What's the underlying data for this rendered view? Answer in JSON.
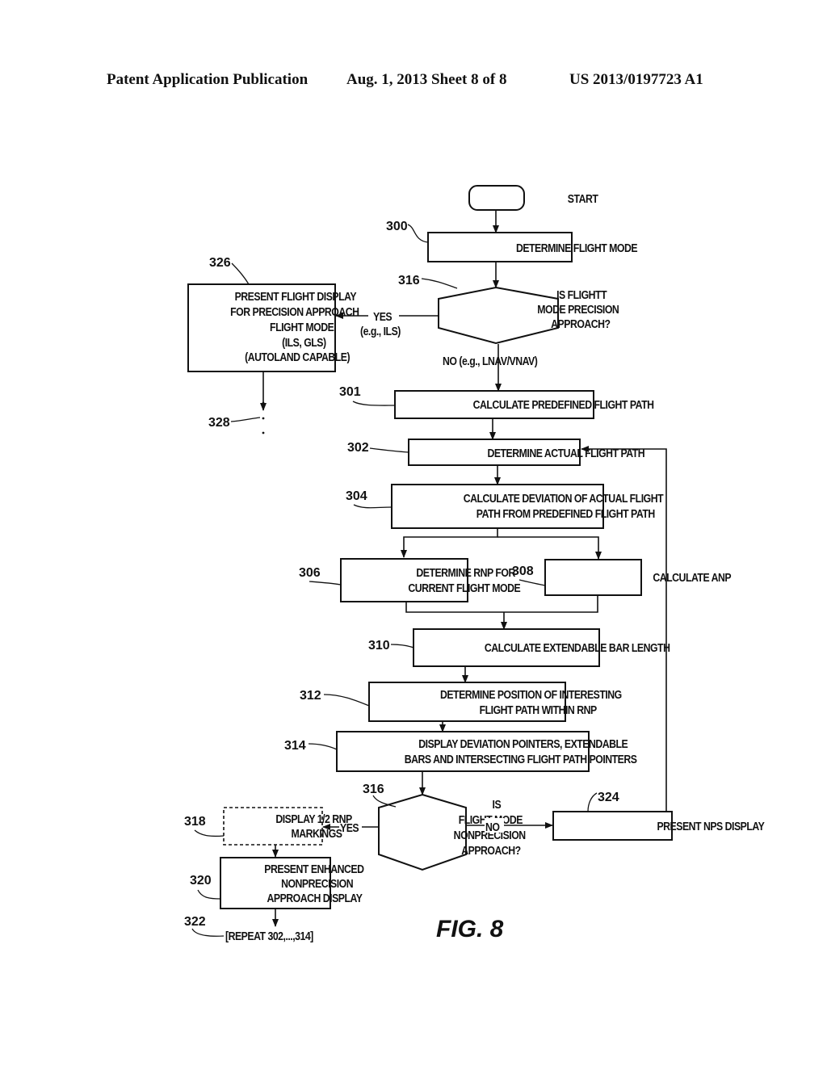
{
  "header": {
    "left": "Patent Application Publication",
    "middle": "Aug. 1, 2013   Sheet 8 of 8",
    "right": "US 2013/0197723 A1"
  },
  "figure_label": "FIG. 8",
  "nodes": {
    "start": {
      "lines": [
        "START"
      ]
    },
    "n300": {
      "ref": "300",
      "lines": [
        "DETERMINE FLIGHT MODE"
      ]
    },
    "n316a": {
      "ref": "316",
      "lines": [
        "IS FLIGHTT",
        "MODE PRECISION",
        "APPROACH?"
      ]
    },
    "n326": {
      "ref": "326",
      "lines": [
        "PRESENT FLIGHT DISPLAY",
        "FOR PRECISION APPROACH",
        "FLIGHT MODE",
        "(ILS, GLS)",
        "(AUTOLAND CAPABLE)"
      ]
    },
    "n328": {
      "ref": "328"
    },
    "n301": {
      "ref": "301",
      "lines": [
        "CALCULATE PREDEFINED FLIGHT PATH"
      ]
    },
    "n302": {
      "ref": "302",
      "lines": [
        "DETERMINE ACTUAL FLIGHT PATH"
      ]
    },
    "n304": {
      "ref": "304",
      "lines": [
        "CALCULATE DEVIATION OF ACTUAL FLIGHT",
        "PATH FROM PREDEFINED  FLIGHT PATH"
      ]
    },
    "n306": {
      "ref": "306",
      "lines": [
        "DETERMINE RNP FOR",
        "CURRENT FLIGHT MODE"
      ]
    },
    "n308": {
      "ref": "308",
      "lines": [
        "CALCULATE ANP"
      ]
    },
    "n310": {
      "ref": "310",
      "lines": [
        "CALCULATE EXTENDABLE BAR LENGTH"
      ]
    },
    "n312": {
      "ref": "312",
      "lines": [
        "DETERMINE POSITION OF INTERESTING",
        "FLIGHT PATH WITHIN RNP"
      ]
    },
    "n314": {
      "ref": "314",
      "lines": [
        "DISPLAY DEVIATION POINTERS, EXTENDABLE",
        "BARS AND INTERSECTING FLIGHT PATH POINTERS"
      ]
    },
    "n316b": {
      "ref": "316",
      "lines": [
        "IS",
        "FLIGHT MODE",
        "NONPRECISION",
        "APPROACH?"
      ]
    },
    "n318": {
      "ref": "318",
      "lines": [
        "DISPLAY 1/2 RNP",
        "MARKINGS"
      ]
    },
    "n320": {
      "ref": "320",
      "lines": [
        "PRESENT ENHANCED",
        "NONPRECISION",
        "APPROACH DISPLAY"
      ]
    },
    "n322": {
      "ref": "322",
      "lines": [
        "[REPEAT 302,...,314]"
      ]
    },
    "n324": {
      "ref": "324",
      "lines": [
        "PRESENT NPS DISPLAY"
      ]
    }
  },
  "edges": {
    "yes_precision": "YES",
    "yes_precision_example": "(e.g., ILS)",
    "no_precision": "NO (e.g., LNAV/VNAV)",
    "yes_nonprecision": "YES",
    "no_nonprecision": "NO"
  }
}
